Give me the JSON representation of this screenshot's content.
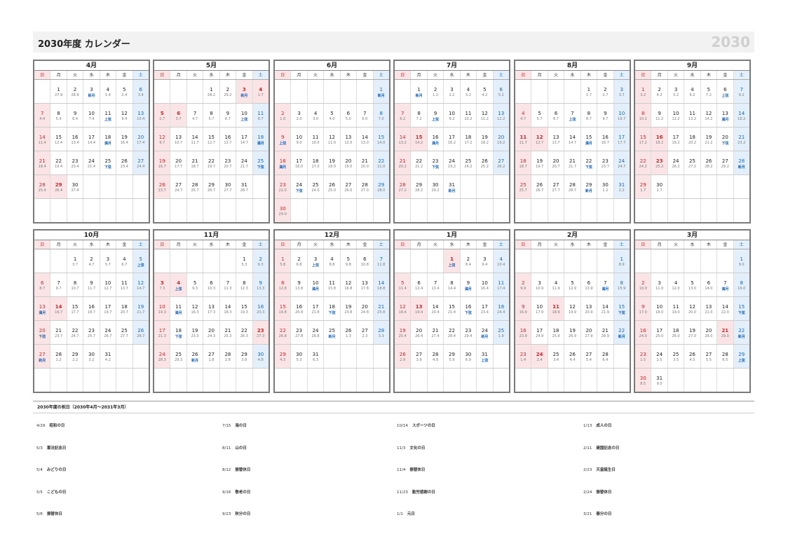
{
  "header": {
    "title": "2030年度 カレンダー",
    "year": "2030"
  },
  "weekdays": [
    "日",
    "月",
    "火",
    "水",
    "木",
    "金",
    "土"
  ],
  "months": [
    {
      "name": "4月",
      "start": 1,
      "days": 30,
      "moon_start": 27.9,
      "holidays": [
        29
      ]
    },
    {
      "name": "5月",
      "start": 3,
      "days": 31,
      "moon_start": 28.2,
      "holidays": [
        3,
        4,
        5,
        6
      ]
    },
    {
      "name": "6月",
      "start": 6,
      "days": 30,
      "moon_start": 0.0,
      "holidays": []
    },
    {
      "name": "7月",
      "start": 1,
      "days": 31,
      "moon_start": 0.2,
      "holidays": [
        15
      ]
    },
    {
      "name": "8月",
      "start": 4,
      "days": 31,
      "moon_start": 1.7,
      "holidays": [
        11,
        12
      ]
    },
    {
      "name": "9月",
      "start": 0,
      "days": 30,
      "moon_start": 3.2,
      "holidays": [
        16,
        23
      ]
    },
    {
      "name": "10月",
      "start": 2,
      "days": 31,
      "moon_start": 3.7,
      "holidays": [
        14
      ]
    },
    {
      "name": "11月",
      "start": 5,
      "days": 30,
      "moon_start": 5.3,
      "holidays": [
        3,
        4,
        23
      ]
    },
    {
      "name": "12月",
      "start": 0,
      "days": 31,
      "moon_start": 5.8,
      "holidays": []
    },
    {
      "name": "1月",
      "start": 3,
      "days": 31,
      "moon_start": 7.4,
      "holidays": [
        1,
        13
      ]
    },
    {
      "name": "2月",
      "start": 6,
      "days": 28,
      "moon_start": 8.9,
      "holidays": [
        11,
        24
      ]
    },
    {
      "name": "3月",
      "start": 6,
      "days": 31,
      "moon_start": 9.0,
      "holidays": [
        21
      ]
    }
  ],
  "moon_labels": {
    "new": "新月",
    "first": "上弦",
    "full": "満月",
    "last": "下弦"
  },
  "holidays_section": {
    "title": "2030年度の祝日（2030年4月～2031年3月）",
    "items": [
      {
        "date": "4/29",
        "name": "昭和の日"
      },
      {
        "date": "5/3",
        "name": "憲法記念日"
      },
      {
        "date": "5/4",
        "name": "みどりの日"
      },
      {
        "date": "5/5",
        "name": "こどもの日"
      },
      {
        "date": "5/6",
        "name": "振替休日"
      },
      {
        "date": "7/15",
        "name": "海の日"
      },
      {
        "date": "8/11",
        "name": "山の日"
      },
      {
        "date": "8/12",
        "name": "振替休日"
      },
      {
        "date": "9/16",
        "name": "敬老の日"
      },
      {
        "date": "9/23",
        "name": "秋分の日"
      },
      {
        "date": "10/14",
        "name": "スポーツの日"
      },
      {
        "date": "11/3",
        "name": "文化の日"
      },
      {
        "date": "11/4",
        "name": "振替休日"
      },
      {
        "date": "11/23",
        "name": "勤労感謝の日"
      },
      {
        "date": "1/1",
        "name": "元日"
      },
      {
        "date": "1/13",
        "name": "成人の日"
      },
      {
        "date": "2/11",
        "name": "建国記念の日"
      },
      {
        "date": "2/23",
        "name": "天皇誕生日"
      },
      {
        "date": "2/24",
        "name": "振替休日"
      },
      {
        "date": "3/21",
        "name": "春分の日"
      }
    ]
  }
}
